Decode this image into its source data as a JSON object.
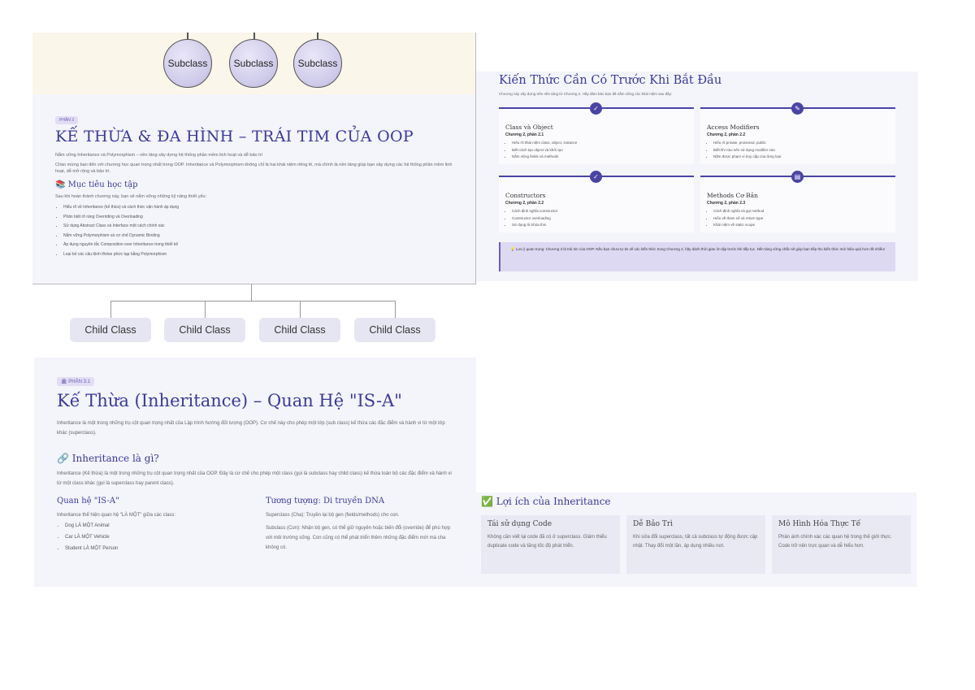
{
  "diagram": {
    "subclasses": [
      "Subclass",
      "Subclass",
      "Subclass"
    ],
    "children": [
      "Child Class",
      "Child Class",
      "Child Class",
      "Child Class"
    ]
  },
  "p1": {
    "badge": "PHẦN 3",
    "title": "KẾ THỪA & ĐA HÌNH – TRÁI TIM CỦA OOP",
    "intro1": "Nắm vững Inheritance và Polymorphism – nền tảng xây dựng hệ thống phần mềm linh hoạt và dễ bảo trì",
    "intro2": "Chào mừng bạn đến với chương học quan trọng nhất trong OOP. Inheritance và Polymorphism không chỉ là hai khái niệm riêng lẻ, mà chính là nền tảng giúp bạn xây dựng các hệ thống phần mềm linh hoạt, dễ mở rộng và bảo trì.",
    "objectives_title": "📚 Mục tiêu học tập",
    "objectives_intro": "Sau khi hoàn thành chương này, bạn sẽ nắm vững những kỹ năng thiết yếu:",
    "objectives": [
      "Hiểu rõ về Inheritance (kế thừa) và cách thức vận hành áp dụng",
      "Phân biệt rõ ràng Overriding và Overloading",
      "Sử dụng Abstract Class và Interface một cách chính xác",
      "Nắm vững Polymorphism và cơ chế Dynamic Binding",
      "Áp dụng nguyên tắc Composition over Inheritance trong thiết kế",
      "Loại bỏ các câu lệnh if/else phức tạp bằng Polymorphism"
    ]
  },
  "p2": {
    "title": "Kiến Thức Cần Có Trước Khi Bắt Đầu",
    "subtitle": "Chương này xây dựng trên nền tảng từ Chương 2. Hãy đảm bảo bạn đã nắm vững các khái niệm sau đây:",
    "cards": [
      {
        "icon": "✓",
        "title": "Class và Object",
        "sub": "Chương 2, phần 2.1",
        "items": [
          "Hiểu rõ khái niệm class, object, instance",
          "Biết cách tạo object và khởi tạo",
          "Nắm vững fields và methods"
        ]
      },
      {
        "icon": "✎",
        "title": "Access Modifiers",
        "sub": "Chương 2, phần 2.2",
        "items": [
          "Hiểu rõ private, protected, public",
          "Biết khi nào nên sử dụng modifier nào",
          "Nắm được phạm vi truy cập của từng loại"
        ]
      },
      {
        "icon": "✓",
        "title": "Constructors",
        "sub": "Chương 2, phần 2.2",
        "items": [
          "Cách định nghĩa constructor",
          "Constructor overloading",
          "Sử dụng từ khóa this"
        ]
      },
      {
        "icon": "▤",
        "title": "Methods Cơ Bản",
        "sub": "Chương 2, phần 2.3",
        "items": [
          "Cách định nghĩa và gọi method",
          "Hiểu về tham số và return type",
          "Khái niệm về static scope"
        ]
      }
    ],
    "note": "💡 Lưu ý quan trọng: Chương 3 là trái tim của OOP. Nếu bạn chưa tự tin về các kiến thức trong Chương 2, hãy dành thời gian ôn tập trước khi tiếp tục. Nền tảng vững chắc sẽ giúp bạn tiếp thu kiến thức mới hiệu quả hơn rất nhiều!"
  },
  "p3": {
    "badge": "🏛 PHẦN 3.1",
    "title": "Kế Thừa (Inheritance) – Quan Hệ \"IS-A\"",
    "intro": "Inheritance là một trong những trụ cột quan trọng nhất của Lập trình hướng đối tượng (OOP). Cơ chế này cho phép một lớp (sub class) kế thừa các đặc điểm và hành vi từ một lớp khác (superclass).",
    "what_title": "🔗 Inheritance là gì?",
    "what_text": "Inheritance (Kế thừa) là một trong những trụ cột quan trọng nhất của OOP. Đây là cơ chế cho phép một class (gọi là subclass hay child class) kế thừa toàn bộ các đặc điểm và hành vi từ một class khác (gọi là superclass hay parent class).",
    "isa_title": "Quan hệ \"IS-A\"",
    "isa_intro": "Inheritance thể hiện quan hệ \"LÀ MỘT\" giữa các class:",
    "isa_items": [
      "Dog LÀ MỘT Animal",
      "Car LÀ MỘT Vehicle",
      "Student LÀ MỘT Person"
    ],
    "dna_title": "Tương tượng: Di truyền DNA",
    "dna_p1": "Superclass (Cha): Truyền lại bộ gen (fields/methods) cho con.",
    "dna_p2": "Subclass (Con): Nhận bộ gen, có thể giữ nguyên hoặc biến đổi (override) để phù hợp với môi trường sống. Con cũng có thể phát triển thêm những đặc điểm mới mà cha không có."
  },
  "p4": {
    "title": "✅ Lợi ích của Inheritance",
    "cards": [
      {
        "title": "Tái sử dụng Code",
        "desc": "Không cần viết lại code đã có ở superclass. Giảm thiểu duplicate code và tăng tốc độ phát triển."
      },
      {
        "title": "Dễ Bảo Trì",
        "desc": "Khi sửa đổi superclass, tất cả subclass tự động được cập nhật. Thay đổi một lần, áp dụng nhiều nơi."
      },
      {
        "title": "Mô Hình Hóa Thực Tế",
        "desc": "Phản ánh chính xác các quan hệ trong thế giới thực. Code trở nên trực quan và dễ hiểu hơn."
      }
    ]
  }
}
